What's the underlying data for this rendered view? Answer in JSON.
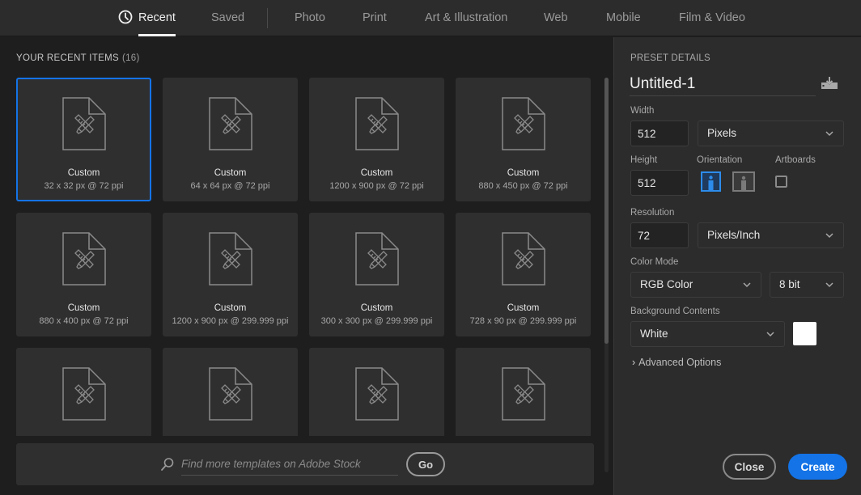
{
  "colors": {
    "accent": "#1473e6",
    "background_swatch": "#ffffff"
  },
  "tabs": [
    {
      "label": "Recent",
      "icon": "clock-icon",
      "active": true
    },
    {
      "label": "Saved",
      "active": false
    },
    {
      "label": "Photo",
      "active": false
    },
    {
      "label": "Print",
      "active": false
    },
    {
      "label": "Art & Illustration",
      "active": false
    },
    {
      "label": "Web",
      "active": false
    },
    {
      "label": "Mobile",
      "active": false
    },
    {
      "label": "Film & Video",
      "active": false
    }
  ],
  "recent": {
    "title": "YOUR RECENT ITEMS",
    "count": "(16)",
    "items": [
      {
        "name": "Custom",
        "dims": "32 x 32 px @ 72 ppi",
        "selected": true
      },
      {
        "name": "Custom",
        "dims": "64 x 64 px @ 72 ppi"
      },
      {
        "name": "Custom",
        "dims": "1200 x 900 px @ 72 ppi"
      },
      {
        "name": "Custom",
        "dims": "880 x 450 px @ 72 ppi"
      },
      {
        "name": "Custom",
        "dims": "880 x 400 px @ 72 ppi"
      },
      {
        "name": "Custom",
        "dims": "1200 x 900 px @ 299.999 ppi"
      },
      {
        "name": "Custom",
        "dims": "300 x 300 px @ 299.999 ppi"
      },
      {
        "name": "Custom",
        "dims": "728 x 90 px @ 299.999 ppi"
      },
      {
        "name": "",
        "dims": ""
      },
      {
        "name": "",
        "dims": ""
      },
      {
        "name": "",
        "dims": ""
      },
      {
        "name": "",
        "dims": ""
      }
    ]
  },
  "stock": {
    "placeholder": "Find more templates on Adobe Stock",
    "go_label": "Go"
  },
  "preset": {
    "section_title": "PRESET DETAILS",
    "name": "Untitled-1",
    "width_label": "Width",
    "width_value": "512",
    "width_unit": "Pixels",
    "height_label": "Height",
    "height_value": "512",
    "orientation_label": "Orientation",
    "orientation": "portrait",
    "artboards_label": "Artboards",
    "artboards_checked": false,
    "resolution_label": "Resolution",
    "resolution_value": "72",
    "resolution_unit": "Pixels/Inch",
    "color_mode_label": "Color Mode",
    "color_mode": "RGB Color",
    "bit_depth": "8 bit",
    "background_label": "Background Contents",
    "background": "White",
    "advanced_label": "Advanced Options",
    "close_label": "Close",
    "create_label": "Create"
  }
}
